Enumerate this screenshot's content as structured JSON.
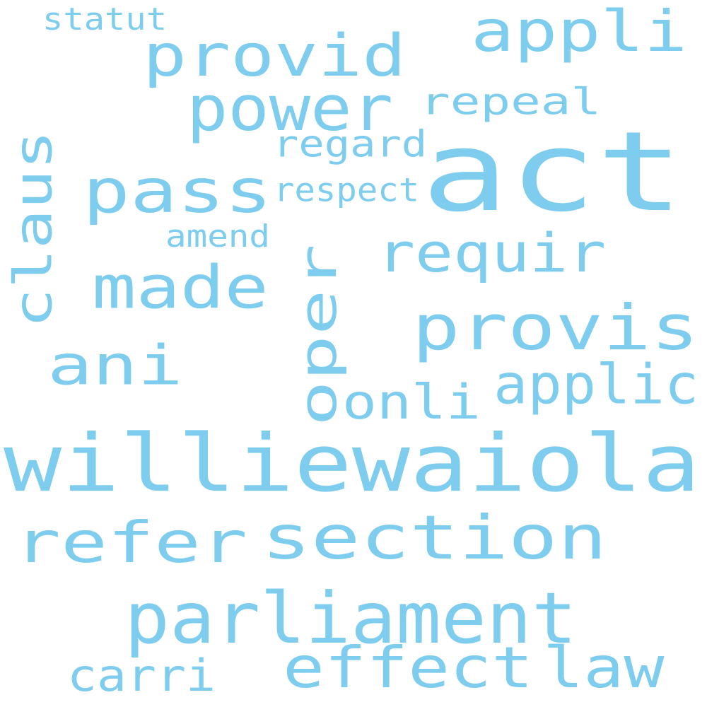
{
  "cloud": {
    "color": "#7ecdee",
    "words": [
      {
        "id": "statut",
        "text": "statut"
      },
      {
        "id": "provid",
        "text": "provid"
      },
      {
        "id": "appli",
        "text": "appli"
      },
      {
        "id": "power",
        "text": "power"
      },
      {
        "id": "repeal",
        "text": "repeal"
      },
      {
        "id": "regard",
        "text": "regard"
      },
      {
        "id": "act",
        "text": "act"
      },
      {
        "id": "pass",
        "text": "pass"
      },
      {
        "id": "respect",
        "text": "respect"
      },
      {
        "id": "claus",
        "text": "claus"
      },
      {
        "id": "amend",
        "text": "amend"
      },
      {
        "id": "requir",
        "text": "requir"
      },
      {
        "id": "made",
        "text": "made"
      },
      {
        "id": "oper",
        "text": "oper"
      },
      {
        "id": "provis",
        "text": "provis"
      },
      {
        "id": "ani",
        "text": "ani"
      },
      {
        "id": "applic",
        "text": "applic"
      },
      {
        "id": "onli",
        "text": "onli"
      },
      {
        "id": "williewaiola",
        "text": "williewaiola"
      },
      {
        "id": "refer",
        "text": "refer"
      },
      {
        "id": "section",
        "text": "section"
      },
      {
        "id": "parliament",
        "text": "parliament"
      },
      {
        "id": "effect",
        "text": "effect"
      },
      {
        "id": "law",
        "text": "law"
      },
      {
        "id": "carri",
        "text": "carri"
      }
    ]
  }
}
